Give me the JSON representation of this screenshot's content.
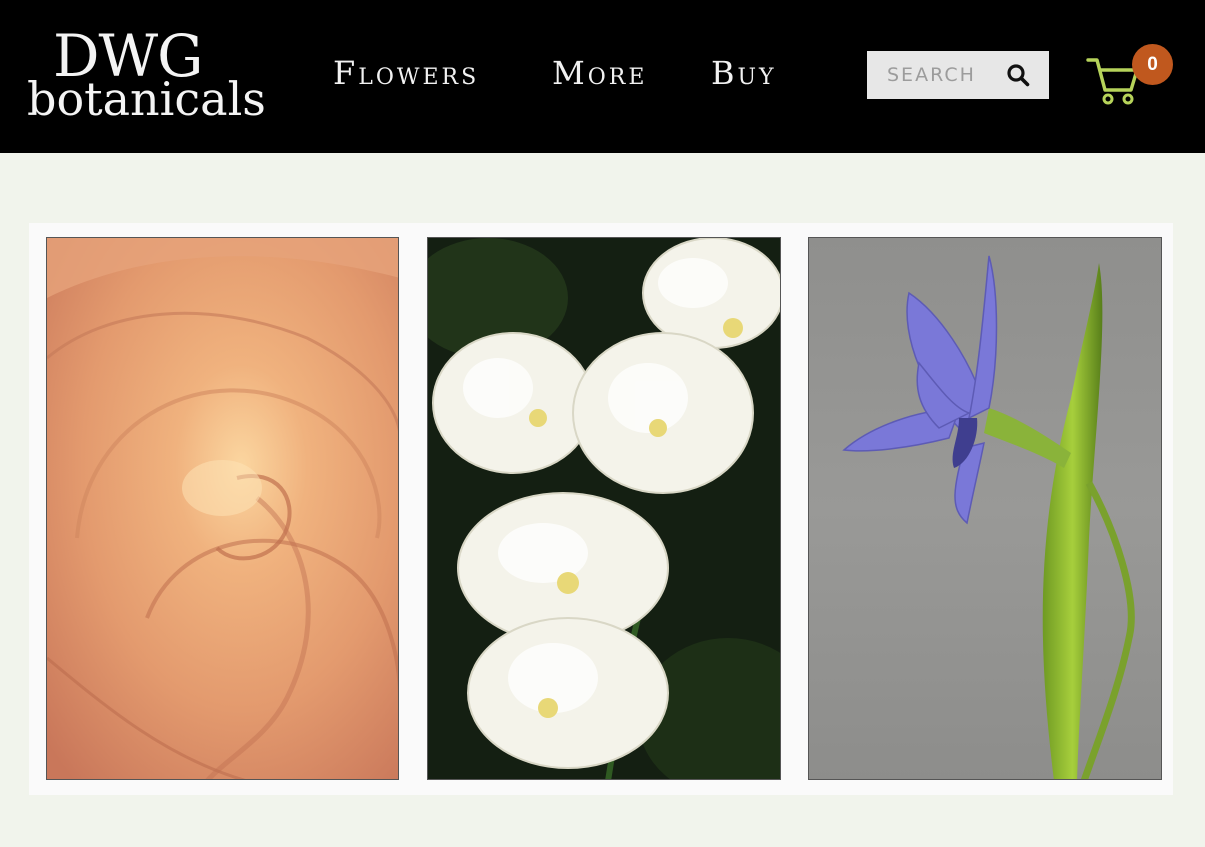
{
  "brand": {
    "line1": "DWG",
    "line2": "botanicals"
  },
  "nav": {
    "items": [
      {
        "label": "Flowers"
      },
      {
        "label": "More"
      },
      {
        "label": "Buy"
      }
    ]
  },
  "search": {
    "placeholder": "SEARCH",
    "icon": "search-icon"
  },
  "cart": {
    "count": "0",
    "icon": "cart-icon",
    "badge_color": "#c0581e",
    "icon_color": "#b6d35a"
  },
  "gallery": {
    "images": [
      {
        "name": "peach-rose-photo",
        "subject": "peach rose"
      },
      {
        "name": "white-peony-tulips-photo",
        "subject": "white double tulips"
      },
      {
        "name": "blue-iris-photo",
        "subject": "blue iris"
      }
    ]
  },
  "colors": {
    "header_bg": "#000000",
    "page_bg": "#f1f4ec"
  }
}
